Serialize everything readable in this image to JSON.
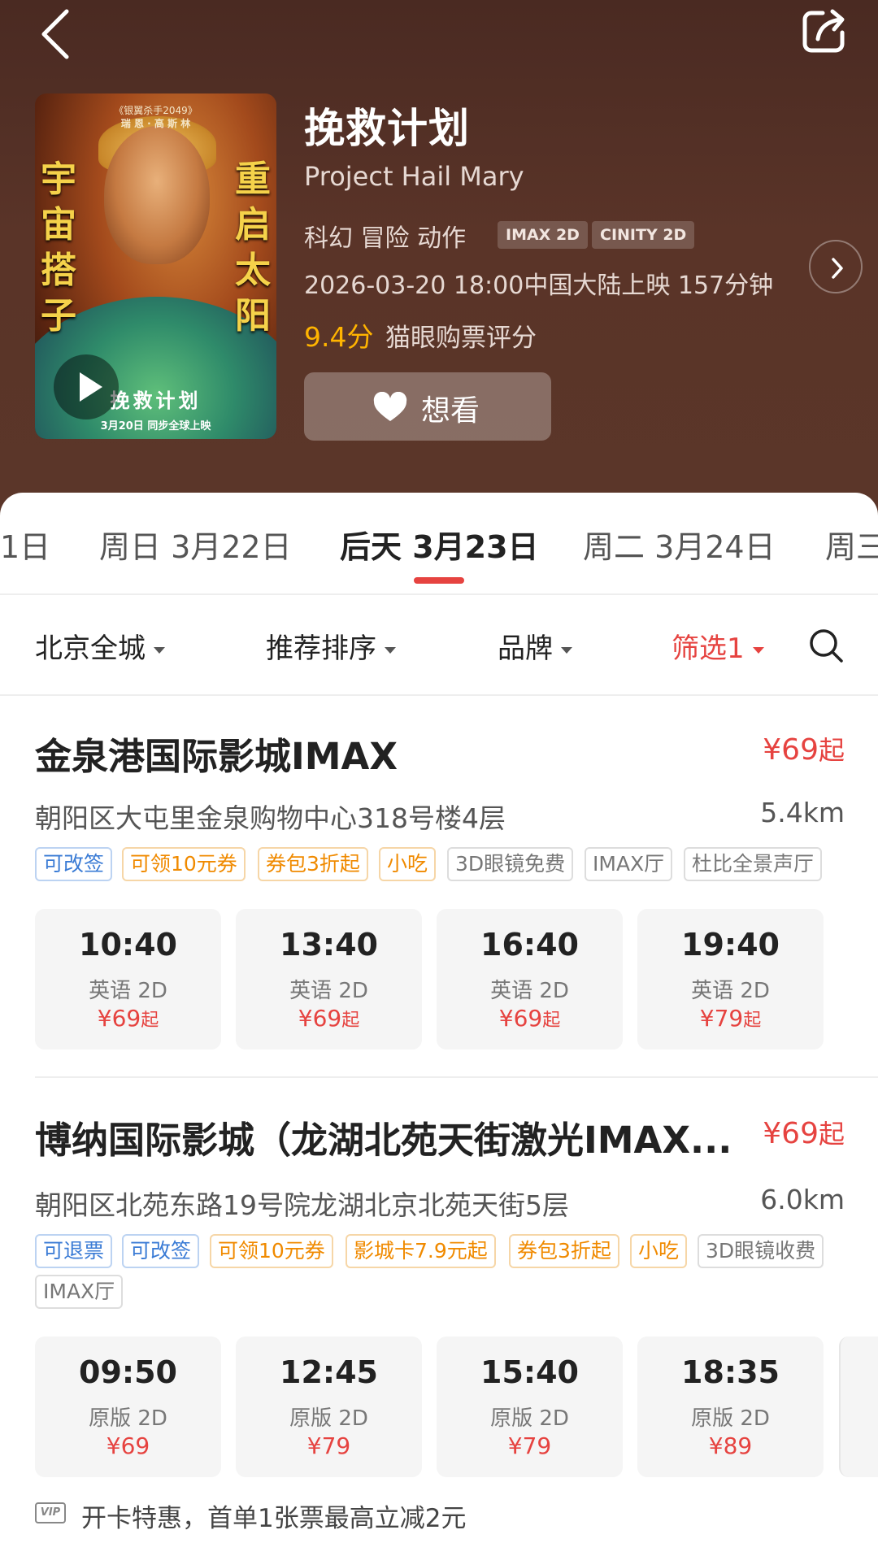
{
  "header": {
    "title": "挽救计划",
    "english_title": "Project Hail Mary",
    "genres": "科幻 冒险 动作",
    "tags": [
      "IMAX 2D",
      "CINITY 2D"
    ],
    "release": "2026-03-20 18:00中国大陆上映 157分钟",
    "rating": "9.4分",
    "rating_label": "猫眼购票评分",
    "want_label": "想看",
    "poster": {
      "top_line_1": "《银翼杀手2049》",
      "top_line_2": "瑞 恩 · 高 斯 林",
      "left_vertical": [
        "宇",
        "宙",
        "搭",
        "子"
      ],
      "right_vertical": [
        "重",
        "启",
        "太",
        "阳"
      ],
      "title": "挽救计划",
      "date": "3月20日 同步全球上映"
    }
  },
  "dates": [
    {
      "label": "1日"
    },
    {
      "label": "周日 3月22日"
    },
    {
      "label": "后天 3月23日"
    },
    {
      "label": "周二 3月24日"
    },
    {
      "label": "周三"
    }
  ],
  "filters": {
    "city": "北京全城",
    "sort": "推荐排序",
    "brand": "品牌",
    "screen": "筛选1"
  },
  "cinemas": [
    {
      "name": "金泉港国际影城IMAX",
      "price": "¥69",
      "price_suffix": "起",
      "address": "朝阳区大屯里金泉购物中心318号楼4层",
      "distance": "5.4km",
      "tags": [
        "可改签",
        "可领10元券",
        "券包3折起",
        "小吃",
        "3D眼镜免费",
        "IMAX厅",
        "杜比全景声厅"
      ],
      "showtimes": [
        {
          "time": "10:40",
          "version": "英语 2D",
          "price": "¥69",
          "suffix": "起"
        },
        {
          "time": "13:40",
          "version": "英语 2D",
          "price": "¥69",
          "suffix": "起"
        },
        {
          "time": "16:40",
          "version": "英语 2D",
          "price": "¥69",
          "suffix": "起"
        },
        {
          "time": "19:40",
          "version": "英语 2D",
          "price": "¥79",
          "suffix": "起"
        }
      ]
    },
    {
      "name": "博纳国际影城（龙湖北苑天街激光IMAX...",
      "price": "¥69",
      "price_suffix": "起",
      "address": "朝阳区北苑东路19号院龙湖北京北苑天街5层",
      "distance": "6.0km",
      "tags": [
        "可退票",
        "可改签",
        "可领10元券",
        "影城卡7.9元起",
        "券包3折起",
        "小吃",
        "3D眼镜收费",
        "IMAX厅"
      ],
      "showtimes": [
        {
          "time": "09:50",
          "version": "原版 2D",
          "price": "¥69"
        },
        {
          "time": "12:45",
          "version": "原版 2D",
          "price": "¥79"
        },
        {
          "time": "15:40",
          "version": "原版 2D",
          "price": "¥79"
        },
        {
          "time": "18:35",
          "version": "原版 2D",
          "price": "¥89"
        }
      ]
    }
  ],
  "promo": {
    "badge": "VIP",
    "text": "开卡特惠，首单1张票最高立减2元"
  },
  "colors": {
    "accent": "#e64340",
    "rating": "#ffb400",
    "header_bg": "#5a3428"
  }
}
